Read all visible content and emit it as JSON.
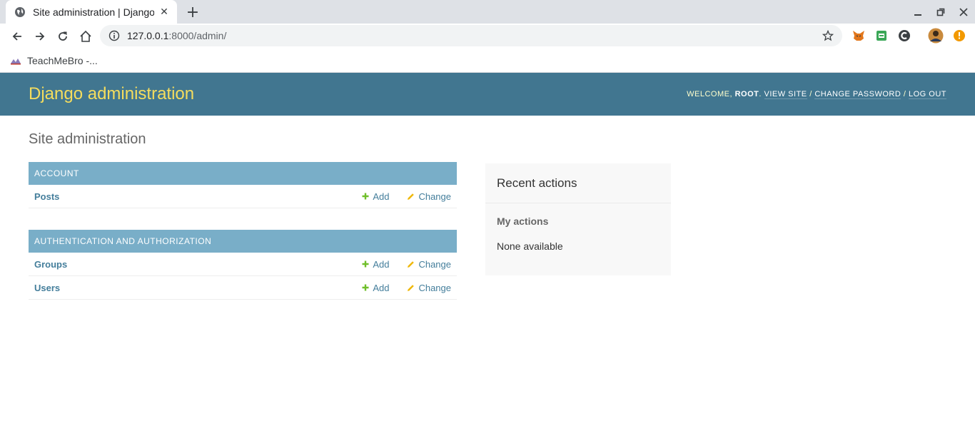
{
  "browser": {
    "tab_title": "Site administration | Django",
    "url_host": "127.0.0.1",
    "url_rest": ":8000/admin/",
    "bookmark_label": "TeachMeBro -..."
  },
  "admin": {
    "site_name": "Django administration",
    "welcome": "Welcome,",
    "username": "root",
    "view_site": "View site",
    "change_password": "Change password",
    "log_out": "Log out",
    "separator": "/",
    "page_title": "Site administration",
    "add_label": "Add",
    "change_label": "Change",
    "modules": [
      {
        "caption": "Account",
        "models": [
          "Posts"
        ]
      },
      {
        "caption": "Authentication and Authorization",
        "models": [
          "Groups",
          "Users"
        ]
      }
    ]
  },
  "recent": {
    "title": "Recent actions",
    "subtitle": "My actions",
    "empty": "None available"
  },
  "colors": {
    "header": "#417690",
    "site_name": "#f5dd5d",
    "caption": "#79aec8",
    "link": "#447e9b",
    "add_icon": "#70bf2b",
    "change_icon": "#efb80b"
  }
}
